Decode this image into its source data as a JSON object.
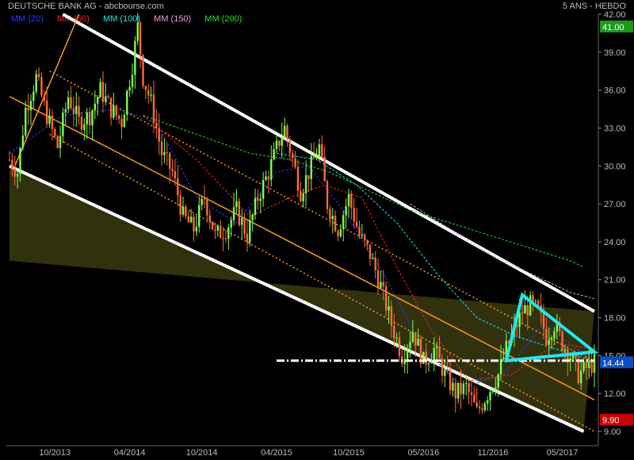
{
  "header": {
    "title": "DEUTSCHE BANK AG - abcbourse.com",
    "period": "5 ANS - HEBDO"
  },
  "legend": [
    {
      "label": "MM (20)",
      "color": "#2a3cff"
    },
    {
      "label": "MM (50)",
      "color": "#ff2020"
    },
    {
      "label": "MM (100)",
      "color": "#20e8f0"
    },
    {
      "label": "MM (150)",
      "color": "#e8a0e8"
    },
    {
      "label": "MM (200)",
      "color": "#20e020"
    }
  ],
  "chart_data": {
    "type": "candlestick",
    "title": "DEUTSCHE BANK AG - abcbourse.com",
    "ylim": [
      9.0,
      42.0
    ],
    "y_ticks": [
      9.0,
      12.0,
      15.0,
      18.0,
      21.0,
      24.0,
      27.0,
      30.0,
      33.0,
      36.0,
      39.0,
      42.0
    ],
    "x_tick_labels": [
      "10/2013",
      "04/2014",
      "10/2014",
      "04/2015",
      "10/2015",
      "05/2016",
      "11/2016",
      "05/2017"
    ],
    "grid": false,
    "price_markers": [
      {
        "value": "41.00",
        "color": "#1a9a1a"
      },
      {
        "value": "14.44",
        "color": "#0b4fc0"
      },
      {
        "value": "9.90",
        "color": "#cc0000"
      }
    ],
    "price_path": [
      [
        0,
        30.5
      ],
      [
        3,
        29.5
      ],
      [
        6,
        34.5
      ],
      [
        10,
        37.0
      ],
      [
        14,
        34.0
      ],
      [
        18,
        31.5
      ],
      [
        22,
        35.5
      ],
      [
        26,
        33.5
      ],
      [
        30,
        34.0
      ],
      [
        34,
        36.0
      ],
      [
        38,
        34.5
      ],
      [
        42,
        33.5
      ],
      [
        46,
        38.0
      ],
      [
        48,
        41.0
      ],
      [
        50,
        37.0
      ],
      [
        53,
        35.0
      ],
      [
        57,
        31.0
      ],
      [
        61,
        29.5
      ],
      [
        65,
        26.0
      ],
      [
        69,
        25.0
      ],
      [
        73,
        27.5
      ],
      [
        77,
        24.5
      ],
      [
        81,
        25.0
      ],
      [
        85,
        26.5
      ],
      [
        89,
        24.5
      ],
      [
        93,
        27.5
      ],
      [
        97,
        29.5
      ],
      [
        101,
        32.0
      ],
      [
        103,
        33.0
      ],
      [
        106,
        30.5
      ],
      [
        109,
        28.0
      ],
      [
        112,
        29.5
      ],
      [
        116,
        31.5
      ],
      [
        119,
        27.0
      ],
      [
        123,
        25.0
      ],
      [
        127,
        27.5
      ],
      [
        131,
        24.5
      ],
      [
        135,
        23.0
      ],
      [
        139,
        20.5
      ],
      [
        143,
        17.5
      ],
      [
        147,
        15.0
      ],
      [
        151,
        17.0
      ],
      [
        155,
        14.5
      ],
      [
        159,
        15.5
      ],
      [
        163,
        13.5
      ],
      [
        167,
        12.0
      ],
      [
        171,
        12.5
      ],
      [
        175,
        10.5
      ],
      [
        179,
        12.0
      ],
      [
        183,
        13.5
      ],
      [
        186,
        15.5
      ],
      [
        189,
        17.0
      ],
      [
        192,
        18.5
      ],
      [
        195,
        19.0
      ],
      [
        198,
        18.5
      ],
      [
        201,
        16.5
      ],
      [
        204,
        17.5
      ],
      [
        207,
        16.0
      ],
      [
        210,
        15.0
      ],
      [
        213,
        13.5
      ],
      [
        216,
        14.0
      ],
      [
        219,
        14.44
      ]
    ],
    "moving_averages": [
      {
        "name": "MM (20)",
        "color": "#2a3cff",
        "points": [
          [
            0,
            31.0
          ],
          [
            20,
            34.0
          ],
          [
            40,
            34.5
          ],
          [
            55,
            33.5
          ],
          [
            70,
            27.5
          ],
          [
            85,
            25.5
          ],
          [
            100,
            29.5
          ],
          [
            112,
            30.0
          ],
          [
            125,
            26.5
          ],
          [
            140,
            21.5
          ],
          [
            155,
            15.5
          ],
          [
            170,
            12.5
          ],
          [
            185,
            13.5
          ],
          [
            200,
            17.5
          ],
          [
            219,
            14.5
          ]
        ]
      },
      {
        "name": "MM (50)",
        "color": "#ff2020",
        "points": [
          [
            50,
            34.0
          ],
          [
            70,
            30.5
          ],
          [
            90,
            26.0
          ],
          [
            105,
            27.5
          ],
          [
            118,
            28.5
          ],
          [
            132,
            27.5
          ],
          [
            145,
            22.0
          ],
          [
            158,
            17.0
          ],
          [
            172,
            13.0
          ],
          [
            188,
            13.5
          ],
          [
            205,
            16.0
          ],
          [
            219,
            15.5
          ]
        ]
      },
      {
        "name": "MM (100)",
        "color": "#20e8f0",
        "points": [
          [
            100,
            31.0
          ],
          [
            115,
            30.5
          ],
          [
            130,
            28.5
          ],
          [
            145,
            25.5
          ],
          [
            160,
            21.5
          ],
          [
            175,
            18.0
          ],
          [
            190,
            16.5
          ],
          [
            205,
            15.5
          ],
          [
            219,
            14.5
          ]
        ]
      },
      {
        "name": "MM (150)",
        "color": "#e8a0e8",
        "points": [
          [
            150,
            27.0
          ],
          [
            165,
            25.0
          ],
          [
            180,
            23.0
          ],
          [
            195,
            21.5
          ],
          [
            210,
            20.0
          ],
          [
            219,
            19.5
          ]
        ]
      },
      {
        "name": "MM (200)",
        "color": "#20e020",
        "points": [
          [
            50,
            34.0
          ],
          [
            70,
            32.5
          ],
          [
            90,
            31.0
          ],
          [
            105,
            30.5
          ],
          [
            120,
            29.5
          ],
          [
            135,
            28.0
          ],
          [
            150,
            26.5
          ],
          [
            165,
            25.5
          ],
          [
            180,
            24.5
          ],
          [
            195,
            23.5
          ],
          [
            210,
            22.5
          ],
          [
            215,
            22.0
          ]
        ]
      }
    ],
    "channel": {
      "upper": [
        [
          20,
          42.0
        ],
        [
          219,
          18.5
        ]
      ],
      "lower": [
        [
          0,
          30.0
        ],
        [
          215,
          9.0
        ]
      ],
      "center": [
        [
          0,
          35.5
        ],
        [
          219,
          11.5
        ]
      ],
      "upper_inner": [
        [
          15,
          37.5
        ],
        [
          219,
          14.5
        ]
      ],
      "lower_inner": [
        [
          15,
          32.5
        ],
        [
          219,
          9.0
        ]
      ]
    },
    "support_line": {
      "value": 14.6,
      "from": 100,
      "to": 219
    },
    "triangle": [
      [
        186,
        14.6
      ],
      [
        192,
        19.8
      ],
      [
        219,
        15.3
      ]
    ]
  }
}
